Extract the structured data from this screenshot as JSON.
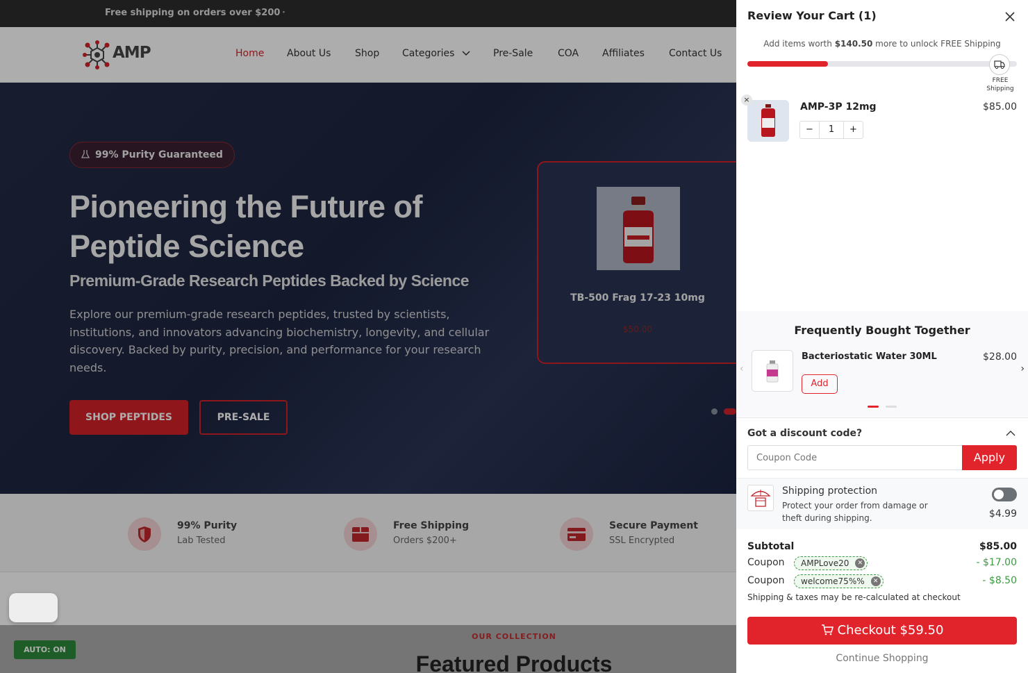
{
  "topbar": {
    "message": "Free shipping on orders over $200",
    "separator": "·"
  },
  "brand": {
    "name": "AMP"
  },
  "nav": {
    "items": [
      "Home",
      "About Us",
      "Shop",
      "Categories",
      "Pre-Sale",
      "COA",
      "Affiliates",
      "Contact Us"
    ]
  },
  "hero": {
    "badge": "99% Purity Guaranteed",
    "title": "Pioneering the Future of Peptide Science",
    "subtitle": "Premium-Grade Research Peptides Backed by Science",
    "description": "Explore our premium-grade research peptides, trusted by scientists, institutions, and innovators advancing biochemistry, longevity, and cellular discovery. Backed by purity, precision, and performance for your research needs.",
    "primary_button": "SHOP PEPTIDES",
    "secondary_button": "PRE-SALE",
    "product": {
      "name": "TB-500 Frag 17-23 10mg",
      "price": "$50.00"
    }
  },
  "features": [
    {
      "title": "99% Purity",
      "subtitle": "Lab Tested",
      "icon": "shield-icon"
    },
    {
      "title": "Free Shipping",
      "subtitle": "Orders $200+",
      "icon": "box-icon"
    },
    {
      "title": "Secure Payment",
      "subtitle": "SSL Encrypted",
      "icon": "credit-card-icon"
    }
  ],
  "collection": {
    "label": "OUR COLLECTION",
    "title": "Featured Products"
  },
  "auto_badge": "AUTO: ON",
  "cart": {
    "title": "Review Your Cart (1)",
    "shipping_msg_prefix": "Add items worth",
    "shipping_amount": "$140.50",
    "shipping_msg_suffix": "more to unlock FREE Shipping",
    "shipping_progress": 0.3,
    "free_shipping_label": "FREE Shipping",
    "item": {
      "name": "AMP-3P 12mg",
      "price": "$85.00",
      "quantity": "1",
      "remove": "×"
    },
    "fbt": {
      "title": "Frequently Bought Together",
      "name": "Bacteriostatic Water 30ML",
      "price": "$28.00",
      "add": "Add"
    },
    "discount": {
      "title": "Got a discount code?",
      "placeholder": "Coupon Code",
      "apply": "Apply"
    },
    "protection": {
      "title": "Shipping protection",
      "description": "Protect your order from damage or theft during shipping.",
      "price": "$4.99",
      "enabled": false
    },
    "subtotal_label": "Subtotal",
    "subtotal": "$85.00",
    "coupon_label": "Coupon",
    "coupons": [
      {
        "code": "AMPLove20",
        "amount": "- $17.00"
      },
      {
        "code": "welcome75%%",
        "amount": "- $8.50"
      }
    ],
    "note": "Shipping & taxes may be re-calculated at checkout",
    "checkout": "Checkout $59.50",
    "continue": "Continue Shopping"
  },
  "colors": {
    "accent": "#e1242b",
    "hero_bg": "#1f2743",
    "coupon_green": "#3a9b41"
  }
}
